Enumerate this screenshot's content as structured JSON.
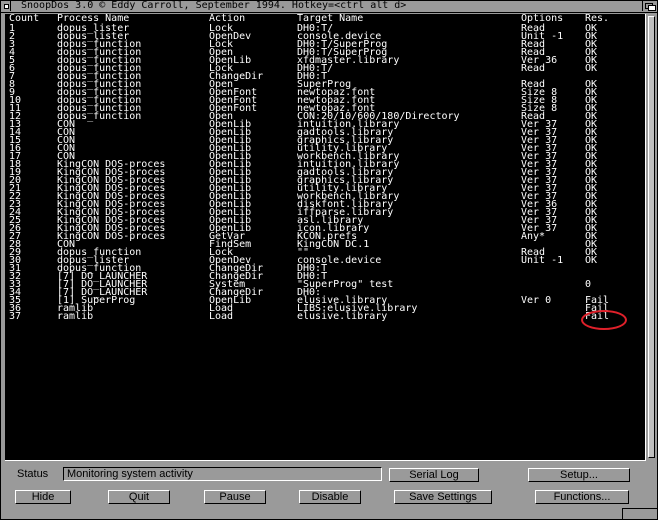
{
  "window": {
    "title": "SnoopDos 3.0 © Eddy Carroll, September 1994. Hotkey=<ctrl alt d>"
  },
  "columns": [
    "Count",
    "Process Name",
    "Action",
    "Target Name",
    "Options",
    "Res."
  ],
  "rows": [
    [
      "1",
      "dopus_lister",
      "Lock",
      "DH0:T/",
      "Read",
      "OK"
    ],
    [
      "2",
      "dopus_lister",
      "OpenDev",
      "console.device",
      "Unit -1",
      "OK"
    ],
    [
      "3",
      "dopus_function",
      "Lock",
      "DH0:T/SuperProg",
      "Read",
      "OK"
    ],
    [
      "4",
      "dopus_function",
      "Open",
      "DH0:T/SuperProg",
      "Read",
      "OK"
    ],
    [
      "5",
      "dopus_function",
      "OpenLib",
      "xfdmaster.library",
      "Ver 36",
      "OK"
    ],
    [
      "6",
      "dopus_function",
      "Lock",
      "DH0:T/",
      "Read",
      "OK"
    ],
    [
      "7",
      "dopus_function",
      "ChangeDir",
      "DH0:T",
      "",
      ""
    ],
    [
      "8",
      "dopus_function",
      "Open",
      "SuperProg",
      "Read",
      "OK"
    ],
    [
      "9",
      "dopus_function",
      "OpenFont",
      "newtopaz.font",
      "Size 8",
      "OK"
    ],
    [
      "10",
      "dopus_function",
      "OpenFont",
      "newtopaz.font",
      "Size 8",
      "OK"
    ],
    [
      "11",
      "dopus_function",
      "OpenFont",
      "newtopaz.font",
      "Size 8",
      "OK"
    ],
    [
      "12",
      "dopus_function",
      "Open",
      "CON:20/10/600/180/Directory",
      "Read",
      "OK"
    ],
    [
      "13",
      "CON",
      "OpenLib",
      "intuition.library",
      "Ver 37",
      "OK"
    ],
    [
      "14",
      "CON",
      "OpenLib",
      "gadtools.library",
      "Ver 37",
      "OK"
    ],
    [
      "15",
      "CON",
      "OpenLib",
      "graphics.library",
      "Ver 37",
      "OK"
    ],
    [
      "16",
      "CON",
      "OpenLib",
      "utility.library",
      "Ver 37",
      "OK"
    ],
    [
      "17",
      "CON",
      "OpenLib",
      "workbench.library",
      "Ver 37",
      "OK"
    ],
    [
      "18",
      "KingCON DOS-proces",
      "OpenLib",
      "intuition.library",
      "Ver 37",
      "OK"
    ],
    [
      "19",
      "KingCON DOS-proces",
      "OpenLib",
      "gadtools.library",
      "Ver 37",
      "OK"
    ],
    [
      "20",
      "KingCON DOS-proces",
      "OpenLib",
      "graphics.library",
      "Ver 37",
      "OK"
    ],
    [
      "21",
      "KingCON DOS-proces",
      "OpenLib",
      "utility.library",
      "Ver 37",
      "OK"
    ],
    [
      "22",
      "KingCON DOS-proces",
      "OpenLib",
      "workbench.library",
      "Ver 37",
      "OK"
    ],
    [
      "23",
      "KingCON DOS-proces",
      "OpenLib",
      "diskfont.library",
      "Ver 36",
      "OK"
    ],
    [
      "24",
      "KingCON DOS-proces",
      "OpenLib",
      "iffparse.library",
      "Ver 37",
      "OK"
    ],
    [
      "25",
      "KingCON DOS-proces",
      "OpenLib",
      "asl.library",
      "Ver 37",
      "OK"
    ],
    [
      "26",
      "KingCON DOS-proces",
      "OpenLib",
      "icon.library",
      "Ver 37",
      "OK"
    ],
    [
      "27",
      "KingCON DOS-proces",
      "GetVar",
      "KCON.prefs",
      "Any*",
      "OK"
    ],
    [
      "28",
      "CON",
      "FindSem",
      "KingCON DC.1",
      "",
      "OK"
    ],
    [
      "29",
      "dopus_function",
      "Lock",
      "\"\"",
      "Read",
      "OK"
    ],
    [
      "30",
      "dopus_lister",
      "OpenDev",
      "console.device",
      "Unit -1",
      "OK"
    ],
    [
      "31",
      "dopus_function",
      "ChangeDir",
      "DH0:T",
      "",
      ""
    ],
    [
      "32",
      "[7] DO_LAUNCHER",
      "ChangeDir",
      "DH0:T",
      "",
      ""
    ],
    [
      "33",
      "[7] DO_LAUNCHER",
      "System",
      "\"SuperProg\" test",
      "",
      "0"
    ],
    [
      "34",
      "[7] DO_LAUNCHER",
      "ChangeDir",
      "DH0:",
      "",
      ""
    ],
    [
      "35",
      "[1] SuperProg",
      "OpenLib",
      "elusive.library",
      "Ver 0",
      "Fail"
    ],
    [
      "36",
      "ramlib",
      "Load",
      "LIBS:elusive.library",
      "",
      "Fail"
    ],
    [
      "37",
      "ramlib",
      "Load",
      "elusive.library",
      "",
      "Fail"
    ]
  ],
  "status": {
    "label": "Status",
    "text": "Monitoring system activity"
  },
  "buttons": {
    "serial_log": "Serial Log",
    "setup": "Setup...",
    "hide": "Hide",
    "quit": "Quit",
    "pause": "Pause",
    "disable": "Disable",
    "save_settings": "Save Settings",
    "functions": "Functions..."
  },
  "colors": {
    "background": "#9a9a9a",
    "list_background": "#000000",
    "list_text": "#ffffff",
    "highlight_ring": "#e0202a"
  }
}
